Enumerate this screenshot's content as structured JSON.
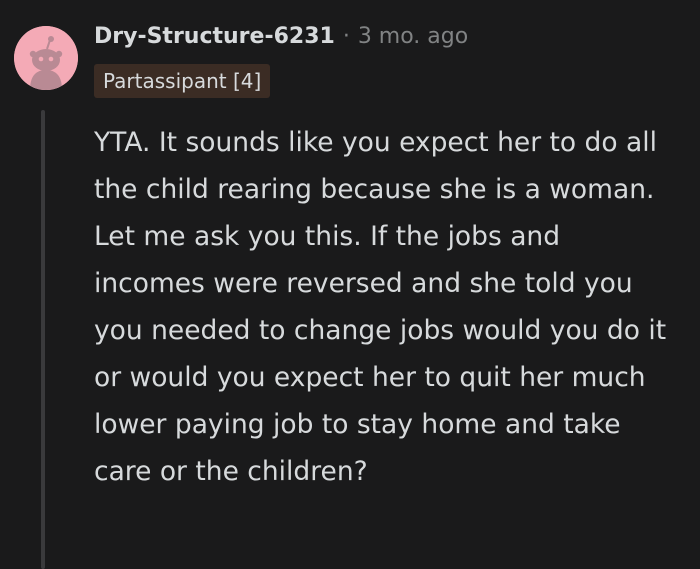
{
  "comment": {
    "author": "Dry-Structure-6231",
    "separator": "·",
    "timestamp": "3 mo. ago",
    "flair": "Partassipant [4]",
    "body": "YTA. It sounds like you expect her to do all the child rearing because she is a woman. Let me ask you this. If the jobs and incomes were reversed and she told you you needed to change jobs would you do it or would you expect her to quit her much lower paying job to stay home and take care or the children?",
    "avatar_icon": "snoo-avatar-icon"
  },
  "colors": {
    "background": "#1a1a1b",
    "text": "#d7dadc",
    "muted": "#818384",
    "avatar_bg": "#f4aab6",
    "flair_bg": "#3b2c24",
    "thread_line": "#3a3a3c"
  }
}
